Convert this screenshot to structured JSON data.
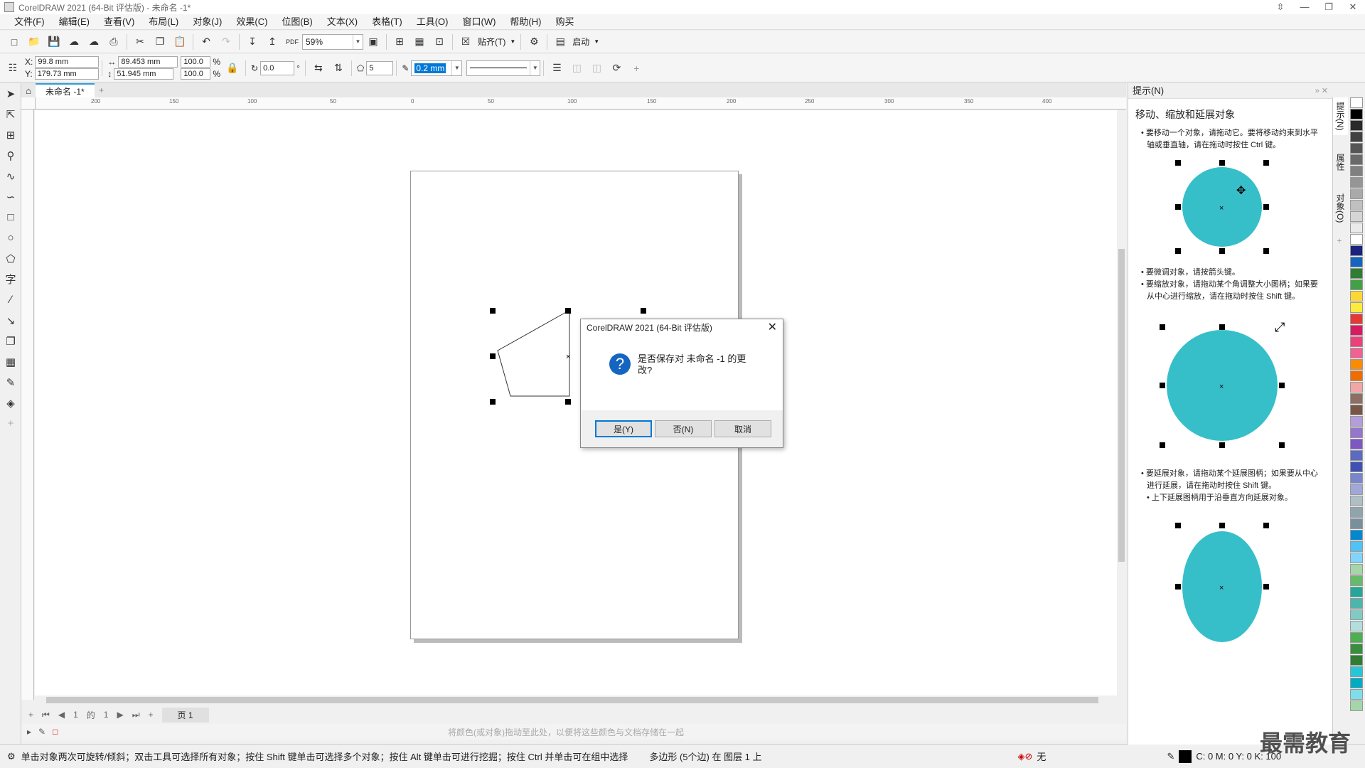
{
  "window": {
    "title": "CorelDRAW 2021 (64-Bit 评估版) - 未命名 -1*",
    "controls": [
      "⇳",
      "—",
      "❐",
      "✕"
    ]
  },
  "menubar": [
    "文件(F)",
    "编辑(E)",
    "查看(V)",
    "布局(L)",
    "对象(J)",
    "效果(C)",
    "位图(B)",
    "文本(X)",
    "表格(T)",
    "工具(O)",
    "窗口(W)",
    "帮助(H)",
    "购买"
  ],
  "stdbar": {
    "zoom": "59%",
    "snap_label": "贴齐(T)",
    "launch_label": "启动"
  },
  "propbar": {
    "x_label": "X:",
    "y_label": "Y:",
    "x_value": "99.8 mm",
    "y_value": "179.73 mm",
    "width_value": "89.453 mm",
    "height_value": "51.945 mm",
    "scale_w": "100.0",
    "scale_h": "100.0",
    "percent": "%",
    "rotation": "0.0",
    "sides": "5",
    "outline_width": "0.2 mm"
  },
  "doc": {
    "tab_label": "未命名 -1*"
  },
  "ruler": {
    "labels": [
      "200",
      "150",
      "100",
      "50",
      "0",
      "50",
      "100",
      "150",
      "200",
      "250",
      "300",
      "350",
      "400"
    ]
  },
  "pagenav": {
    "current": "1",
    "of": "的",
    "total": "1",
    "page_tab": "页 1"
  },
  "colorhint": {
    "text": "将颜色(或对象)拖动至此处，以便将这些颜色与文档存储在一起"
  },
  "status": {
    "hint": "单击对象两次可旋转/倾斜；双击工具可选择所有对象；按住 Shift 键单击可选择多个对象；按住 Alt 键单击可进行挖掘；按住 Ctrl 并单击可在组中选择",
    "object_info": "多边形 (5个边) 在 图层 1 上",
    "fill_label": "无",
    "color_values": "C: 0 M: 0 Y: 0 K: 100"
  },
  "docker": {
    "title": "提示(N)",
    "heading": "移动、缩放和延展对象",
    "p1": "• 要移动一个对象，请拖动它。要将移动约束到水平轴或垂直轴，请在拖动时按住 Ctrl 键。",
    "p2": "• 要微调对象，请按箭头键。",
    "p3": "• 要缩放对象，请拖动某个角调整大小图柄；如果要从中心进行缩放，请在拖动时按住 Shift 键。",
    "p4": "• 要延展对象，请拖动某个延展图柄；如果要从中心进行延展，请在拖动时按住 Shift 键。",
    "p5": "• 上下延展图柄用于沿垂直方向延展对象。",
    "circle_color": "#36bfc9",
    "side_tabs": [
      "提示(N)",
      "属性",
      "对象(O)"
    ]
  },
  "dialog": {
    "title": "CorelDRAW 2021 (64-Bit 评估版)",
    "message": "是否保存对 未命名 -1 的更改?",
    "yes": "是(Y)",
    "no": "否(N)",
    "cancel": "取消"
  },
  "palette": [
    "#ffffff",
    "#000000",
    "#2a2a2a",
    "#404040",
    "#555555",
    "#6a6a6a",
    "#808080",
    "#959595",
    "#aaaaaa",
    "#c0c0c0",
    "#d5d5d5",
    "#eaeaea",
    "#ffffff",
    "#1a237e",
    "#1565c0",
    "#2e7d32",
    "#43a047",
    "#fdd835",
    "#ffeb3b",
    "#e53935",
    "#d81b60",
    "#ec407a",
    "#f06292",
    "#fb8c00",
    "#ef6c00",
    "#f4a6a6",
    "#8d6e63",
    "#795548",
    "#b39ddb",
    "#9575cd",
    "#7e57c2",
    "#5c6bc0",
    "#3f51b5",
    "#7986cb",
    "#9fa8da",
    "#b0bec5",
    "#90a4ae",
    "#78909c",
    "#0288d1",
    "#4fc3f7",
    "#81d4fa",
    "#a5d6a7",
    "#66bb6a",
    "#26a69a",
    "#4db6ac",
    "#80cbc4",
    "#b2dfdb",
    "#4caf50",
    "#388e3c",
    "#2e7d32",
    "#26c6da",
    "#00acc1",
    "#80deea",
    "#a5d6a7"
  ],
  "watermark": "最需教育"
}
